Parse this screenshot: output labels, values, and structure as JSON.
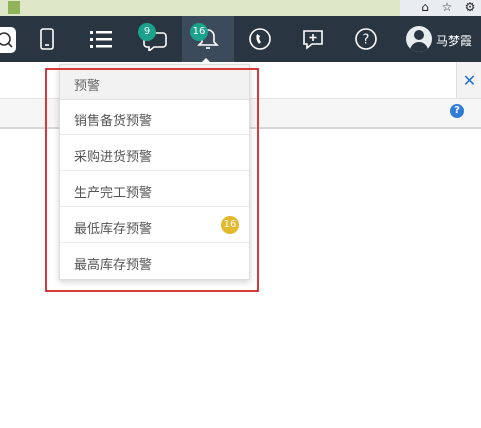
{
  "navbar": {
    "badges": {
      "messages": "9",
      "alerts": "16"
    },
    "user_name": "马梦霞"
  },
  "content": {
    "close_label": "✕",
    "help_label": "?"
  },
  "dropdown": {
    "header": "预警",
    "items": [
      {
        "label": "销售备货预警",
        "badge": ""
      },
      {
        "label": "采购进货预警",
        "badge": ""
      },
      {
        "label": "生产完工预警",
        "badge": ""
      },
      {
        "label": "最低库存预警",
        "badge": "16"
      },
      {
        "label": "最高库存预警",
        "badge": ""
      }
    ]
  },
  "colors": {
    "navbar_bg": "#2a3542",
    "badge_green": "#1aa28a",
    "badge_yellow": "#e2b92b",
    "annotation_red": "#d9393a"
  }
}
